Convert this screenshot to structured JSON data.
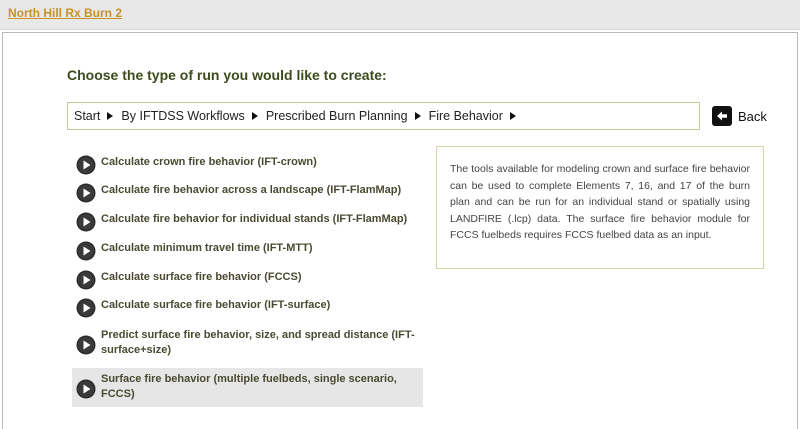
{
  "header": {
    "project_link": "North Hill Rx Burn 2"
  },
  "main": {
    "heading": "Choose the type of run you would like to create:",
    "breadcrumb": [
      "Start",
      "By IFTDSS Workflows",
      "Prescribed Burn Planning",
      "Fire Behavior"
    ],
    "back_label": "Back",
    "options": [
      "Calculate crown fire behavior (IFT-crown)",
      "Calculate fire behavior across a landscape (IFT-FlamMap)",
      "Calculate fire behavior for individual stands (IFT-FlamMap)",
      "Calculate minimum travel time (IFT-MTT)",
      "Calculate surface fire behavior (FCCS)",
      "Calculate surface fire behavior (IFT-surface)",
      "Predict surface fire behavior, size, and spread distance (IFT-surface+size)",
      "Surface fire behavior (multiple fuelbeds, single scenario, FCCS)"
    ],
    "info_text": "The tools available for modeling crown and surface fire behavior can be used to complete Elements 7, 16, and 17 of the burn plan and can be run for an individual stand or spatially using LANDFIRE (.lcp) data. The surface fire behavior module for FCCS fuelbeds requires FCCS fuelbed data as an input."
  },
  "colors": {
    "link": "#c8922b",
    "heading": "#3e4a1e",
    "breadcrumb_border": "#c2c998",
    "info_border": "#d9d3a8",
    "selected_bg": "#e6e6e6"
  },
  "icons": {
    "option": "play-circle-icon",
    "back": "back-arrow-icon",
    "crumb_separator": "triangle-right-icon"
  }
}
